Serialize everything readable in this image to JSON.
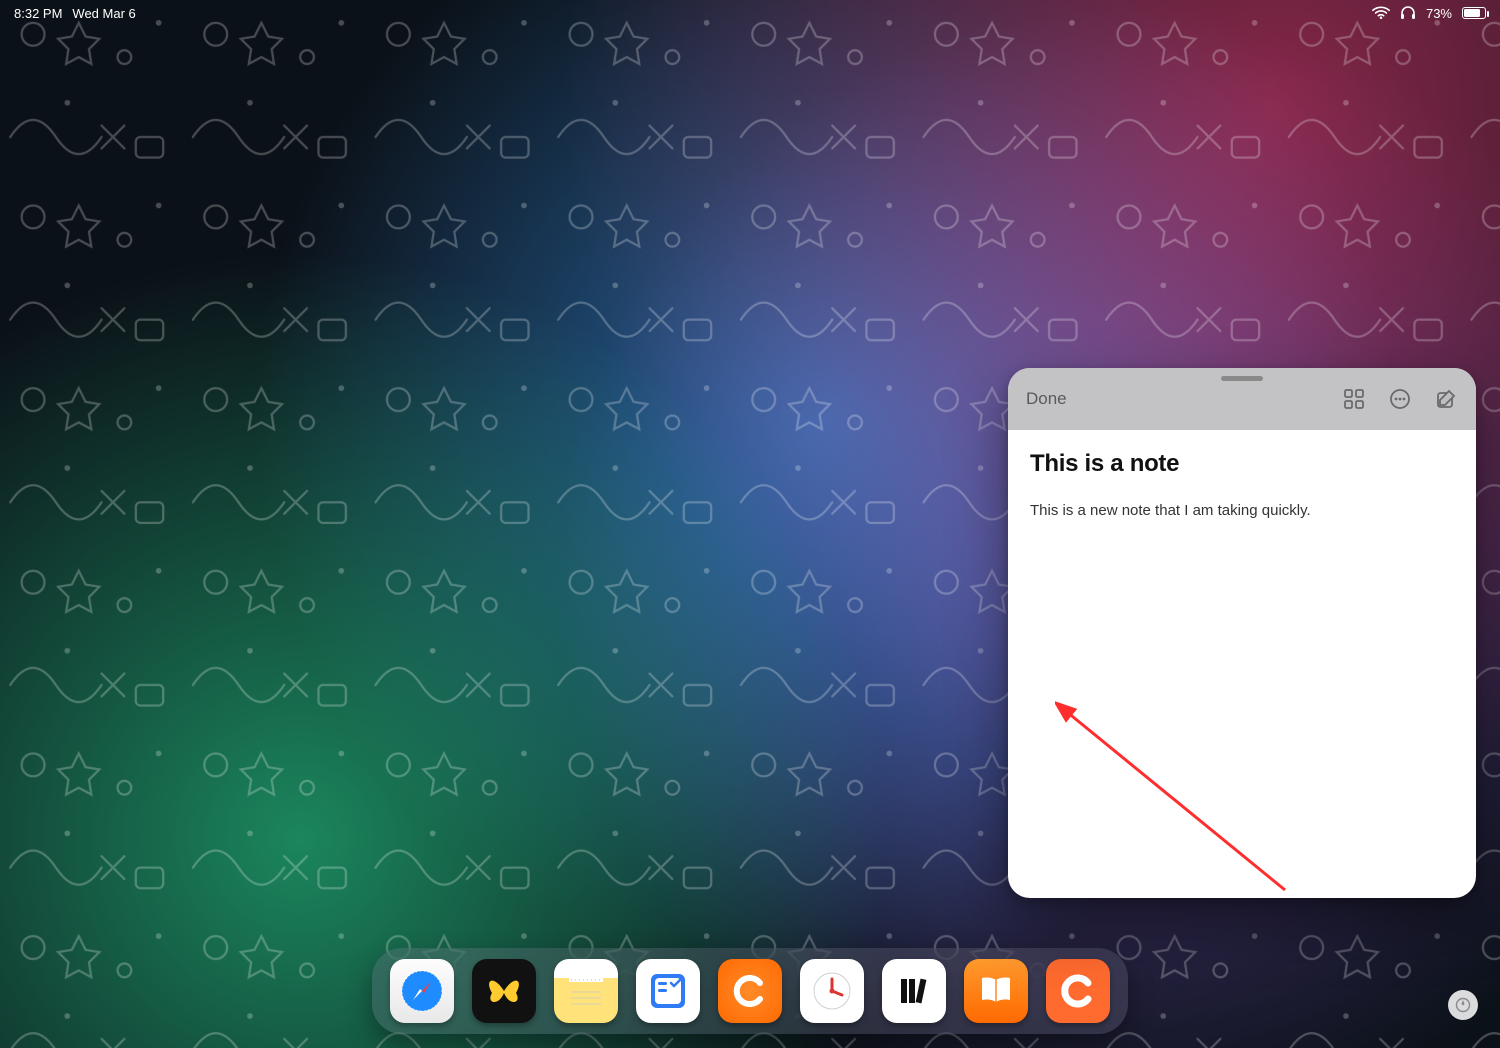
{
  "status": {
    "time": "8:32 PM",
    "date": "Wed Mar 6",
    "battery_percent": "73%"
  },
  "quicknote": {
    "done_label": "Done",
    "title": "This is a note",
    "body": "This is a new note that I am taking quickly."
  },
  "dock": {
    "apps": [
      {
        "name": "safari"
      },
      {
        "name": "butterfly-app"
      },
      {
        "name": "notes"
      },
      {
        "name": "tasks-app"
      },
      {
        "name": "orange-c-app"
      },
      {
        "name": "clock-app"
      },
      {
        "name": "library-app"
      },
      {
        "name": "books"
      },
      {
        "name": "orange-c2-app"
      }
    ]
  }
}
